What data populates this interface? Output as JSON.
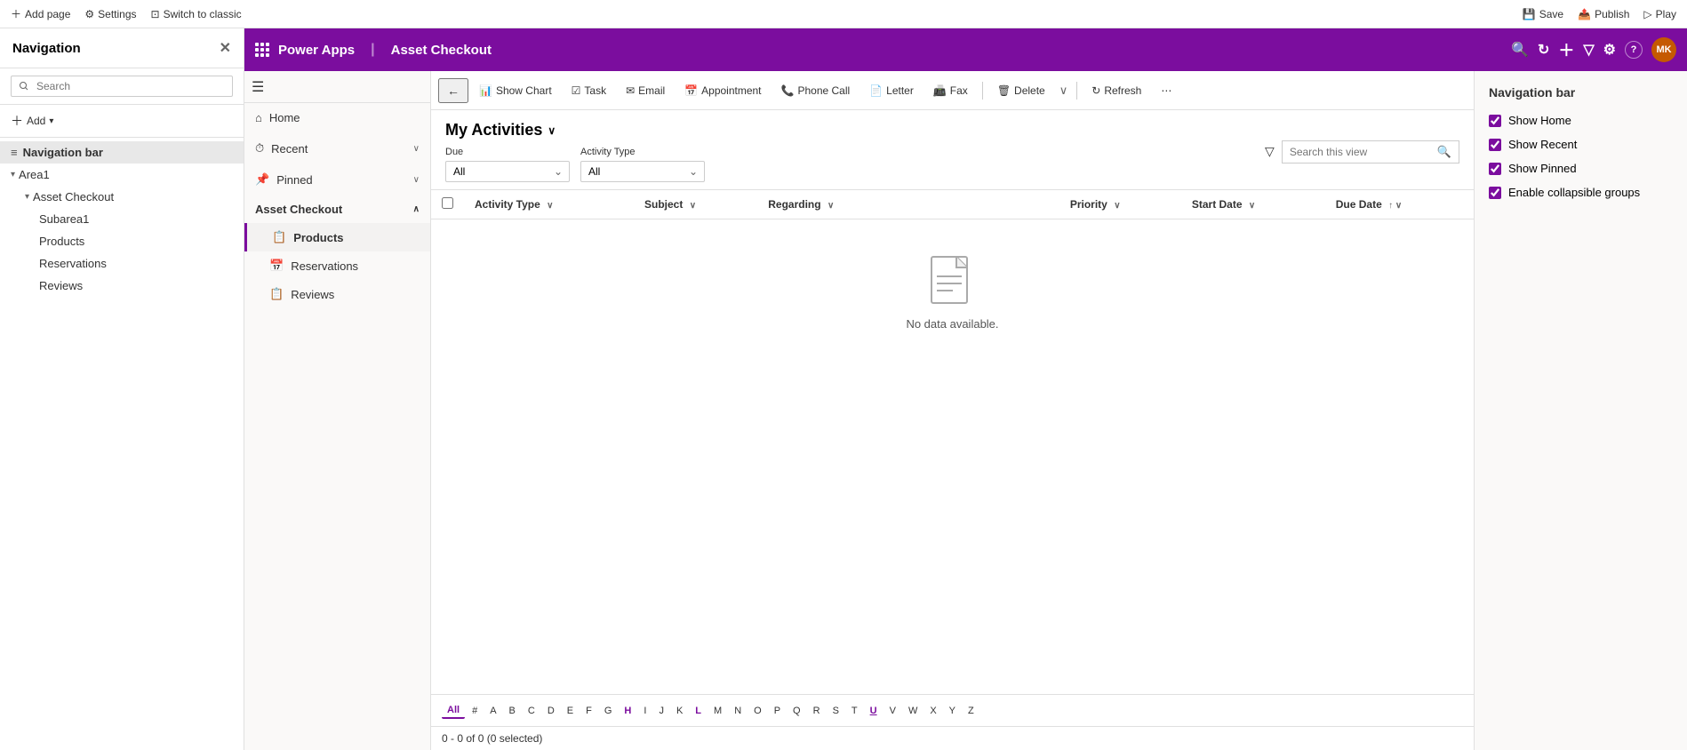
{
  "topbar": {
    "add_page": "Add page",
    "settings": "Settings",
    "switch_to_classic": "Switch to classic",
    "save": "Save",
    "publish": "Publish",
    "play": "Play"
  },
  "left_panel": {
    "title": "Navigation",
    "search_placeholder": "Search",
    "add_label": "Add",
    "tree": [
      {
        "id": "nav-bar",
        "label": "Navigation bar",
        "level": 0,
        "icon": "≡",
        "selected": true
      },
      {
        "id": "area1",
        "label": "Area1",
        "level": 0,
        "expanded": true
      },
      {
        "id": "asset-checkout",
        "label": "Asset Checkout",
        "level": 1,
        "expanded": true
      },
      {
        "id": "subarea1",
        "label": "Subarea1",
        "level": 2
      },
      {
        "id": "products-left",
        "label": "Products",
        "level": 2
      },
      {
        "id": "reservations-left",
        "label": "Reservations",
        "level": 2
      },
      {
        "id": "reviews-left",
        "label": "Reviews",
        "level": 2
      }
    ]
  },
  "powerapps_header": {
    "waffle_label": "Apps menu",
    "app_name": "Power Apps",
    "page_title": "Asset Checkout",
    "user_initials": "MK"
  },
  "sidebar": {
    "items": [
      {
        "id": "home",
        "label": "Home",
        "icon": "⌂"
      },
      {
        "id": "recent",
        "label": "Recent",
        "icon": "⏱",
        "expandable": true
      },
      {
        "id": "pinned",
        "label": "Pinned",
        "icon": "📌",
        "expandable": true
      }
    ],
    "group": "Asset Checkout",
    "group_items": [
      {
        "id": "products",
        "label": "Products",
        "icon": "📋",
        "active": true
      },
      {
        "id": "reservations",
        "label": "Reservations",
        "icon": "📅"
      },
      {
        "id": "reviews",
        "label": "Reviews",
        "icon": "📋"
      }
    ]
  },
  "command_bar": {
    "show_chart": "Show Chart",
    "task": "Task",
    "email": "Email",
    "appointment": "Appointment",
    "phone_call": "Phone Call",
    "letter": "Letter",
    "fax": "Fax",
    "delete": "Delete",
    "refresh": "Refresh"
  },
  "main_view": {
    "title": "My Activities",
    "filter_due_label": "Due",
    "filter_due_value": "All",
    "filter_activity_type_label": "Activity Type",
    "filter_activity_type_value": "All",
    "search_placeholder": "Search this view",
    "columns": [
      {
        "id": "activity-type",
        "label": "Activity Type",
        "sortable": true
      },
      {
        "id": "subject",
        "label": "Subject",
        "sortable": true
      },
      {
        "id": "regarding",
        "label": "Regarding",
        "sortable": true
      },
      {
        "id": "priority",
        "label": "Priority",
        "sortable": true
      },
      {
        "id": "start-date",
        "label": "Start Date",
        "sortable": true
      },
      {
        "id": "due-date",
        "label": "Due Date",
        "sortable": true,
        "sorted": "asc"
      }
    ],
    "empty_message": "No data available.",
    "pagination_letters": [
      "All",
      "#",
      "A",
      "B",
      "C",
      "D",
      "E",
      "F",
      "G",
      "H",
      "I",
      "J",
      "K",
      "L",
      "M",
      "N",
      "O",
      "P",
      "Q",
      "R",
      "S",
      "T",
      "U",
      "V",
      "W",
      "X",
      "Y",
      "Z"
    ],
    "active_letter": "All",
    "pagination_info": "0 - 0 of 0 (0 selected)"
  },
  "right_panel": {
    "title": "Navigation bar",
    "options": [
      {
        "id": "show-home",
        "label": "Show Home",
        "checked": true
      },
      {
        "id": "show-recent",
        "label": "Show Recent",
        "checked": true
      },
      {
        "id": "show-pinned",
        "label": "Show Pinned",
        "checked": true
      },
      {
        "id": "enable-collapsible",
        "label": "Enable collapsible groups",
        "checked": true
      }
    ]
  },
  "icons": {
    "waffle": "⊞",
    "search": "🔍",
    "add": "+",
    "filter": "▽",
    "gear": "⚙",
    "question": "?",
    "close": "✕",
    "back": "←",
    "chevron_down": "∨",
    "chevron_right": "›",
    "more": "···",
    "refresh": "↻",
    "check": "✓"
  }
}
